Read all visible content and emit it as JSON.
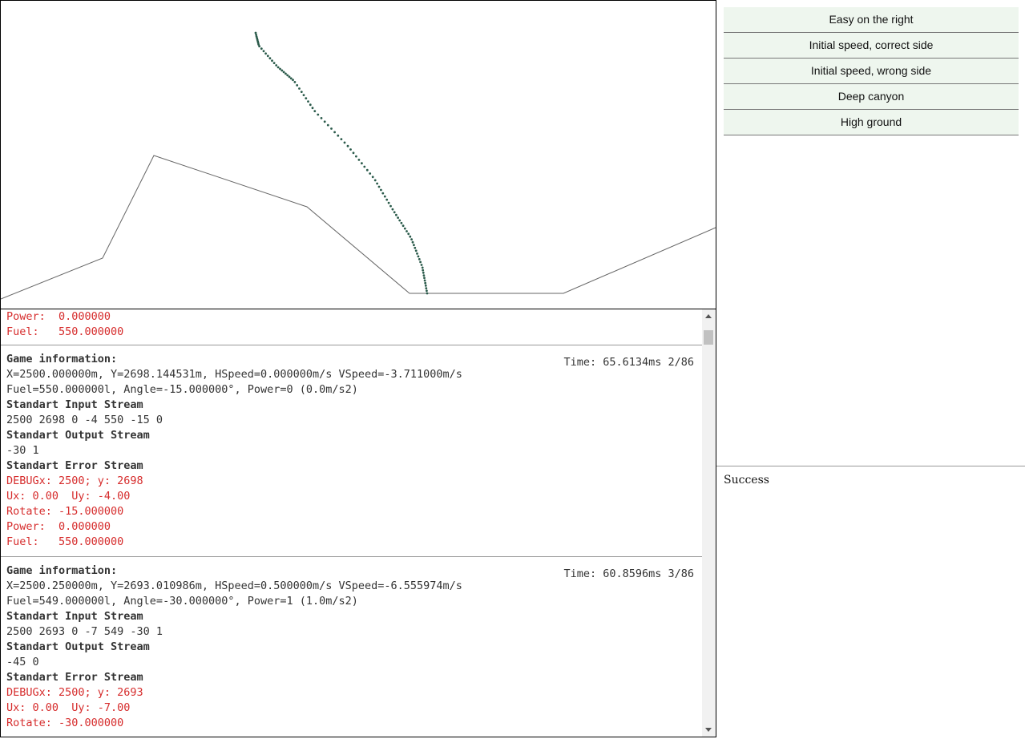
{
  "colors": {
    "terrain": "#666666",
    "trajectory": "#2a5a4a",
    "error": "#d62c2c"
  },
  "game": {
    "terrain": [
      [
        0,
        372
      ],
      [
        127,
        321
      ],
      [
        191,
        193
      ],
      [
        382,
        257
      ],
      [
        510,
        365
      ],
      [
        702,
        365
      ],
      [
        892,
        283
      ]
    ]
  },
  "tests": [
    {
      "label": "Easy on the right"
    },
    {
      "label": "Initial speed, correct side"
    },
    {
      "label": "Initial speed, wrong side"
    },
    {
      "label": "Deep canyon"
    },
    {
      "label": "High ground"
    }
  ],
  "result": {
    "text": "Success"
  },
  "log": {
    "top_fragment": [
      "Power:  0.000000",
      "Fuel:   550.000000"
    ],
    "turns": [
      {
        "title": "Game information:",
        "time": "Time: 65.6134ms 2/86",
        "info": [
          "X=2500.000000m, Y=2698.144531m, HSpeed=0.000000m/s VSpeed=-3.711000m/s",
          "Fuel=550.000000l, Angle=-15.000000°, Power=0 (0.0m/s2)"
        ],
        "input_label": "Standart Input Stream",
        "input": "2500 2698 0 -4 550 -15 0",
        "output_label": "Standart Output Stream",
        "output": "-30 1",
        "error_label": "Standart Error Stream",
        "errors": [
          "DEBUGx: 2500; y: 2698",
          "Ux: 0.00  Uy: -4.00",
          "Rotate: -15.000000",
          "Power:  0.000000",
          "Fuel:   550.000000"
        ]
      },
      {
        "title": "Game information:",
        "time": "Time: 60.8596ms 3/86",
        "info": [
          "X=2500.250000m, Y=2693.010986m, HSpeed=0.500000m/s VSpeed=-6.555974m/s",
          "Fuel=549.000000l, Angle=-30.000000°, Power=1 (1.0m/s2)"
        ],
        "input_label": "Standart Input Stream",
        "input": "2500 2693 0 -7 549 -30 1",
        "output_label": "Standart Output Stream",
        "output": "-45 0",
        "error_label": "Standart Error Stream",
        "errors": [
          "DEBUGx: 2500; y: 2693",
          "Ux: 0.00  Uy: -7.00",
          "Rotate: -30.000000"
        ]
      }
    ]
  }
}
